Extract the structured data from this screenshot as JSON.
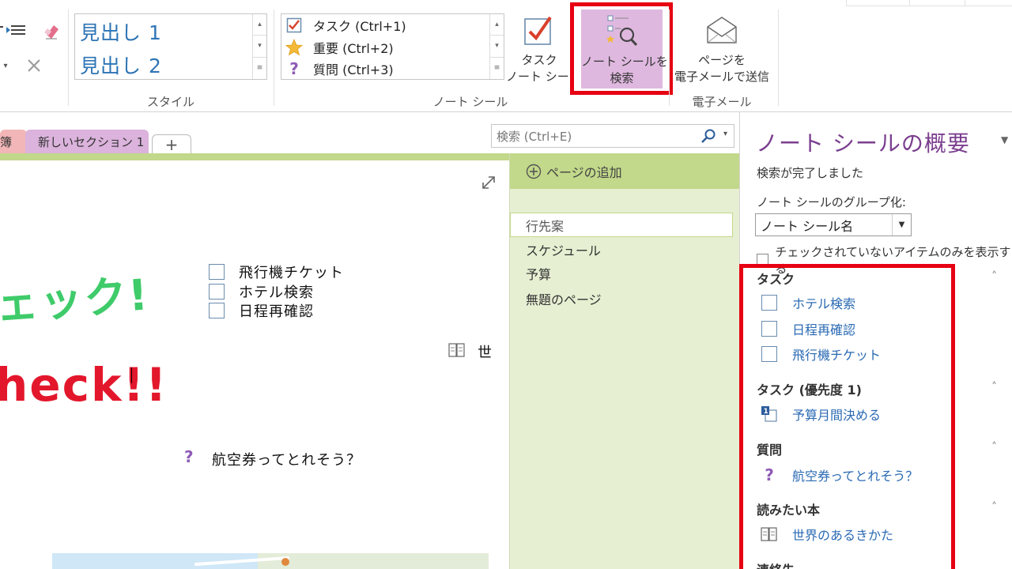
{
  "ribbon": {
    "styles": {
      "heading1": "見出し 1",
      "heading2": "見出し 2",
      "group_label": "スタイル"
    },
    "tags": {
      "items": [
        {
          "label": "タスク (Ctrl+1)",
          "icon": "checkbox-checked-icon"
        },
        {
          "label": "重要 (Ctrl+2)",
          "icon": "star-icon"
        },
        {
          "label": "質問 (Ctrl+3)",
          "icon": "question-icon"
        }
      ],
      "todo_button": "タスク",
      "todo_button_line2": "ノート シール",
      "find_tags_line1": "ノート シールを",
      "find_tags_line2": "検索",
      "group_label": "ノート シール"
    },
    "email": {
      "line1": "ページを",
      "line2": "電子メールで送信",
      "group_label": "電子メール"
    }
  },
  "sections": {
    "partial_tab": "簿",
    "tab1": "新しいセクション 1",
    "add_tab": "+"
  },
  "search": {
    "placeholder": "検索 (Ctrl+E)"
  },
  "canvas": {
    "todos": [
      "飛行機チケット",
      "ホテル検索",
      "日程再確認"
    ],
    "question": "航空券ってとれそう？",
    "book_tag_text": "世",
    "handwriting_line1": "ェック!",
    "handwriting_line2": "heck!!"
  },
  "pagelist": {
    "add_page": "ページの追加",
    "pages": [
      "行先案",
      "スケジュール",
      "予算",
      "無題のページ"
    ]
  },
  "pane": {
    "title": "ノート シールの概要",
    "status": "検索が完了しました",
    "group_by_label": "ノート シールのグループ化:",
    "group_by_value": "ノート シール名",
    "unchecked_only": "チェックされていないアイテムのみを表示する",
    "groups": [
      {
        "heading": "タスク",
        "items": [
          "ホテル検索",
          "日程再確認",
          "飛行機チケット"
        ]
      },
      {
        "heading": "タスク (優先度 1)",
        "items": [
          "予算月間決める"
        ]
      },
      {
        "heading": "質問",
        "items": [
          "航空券ってとれそう？"
        ]
      },
      {
        "heading": "読みたい本",
        "items": [
          "世界のあるきかた"
        ]
      },
      {
        "heading": "連絡先",
        "items": []
      }
    ]
  },
  "colors": {
    "accent_purple": "#7b3f8f",
    "highlight_red": "#e60012",
    "section_green": "#c2d88a",
    "link_blue": "#2a6ab3"
  }
}
